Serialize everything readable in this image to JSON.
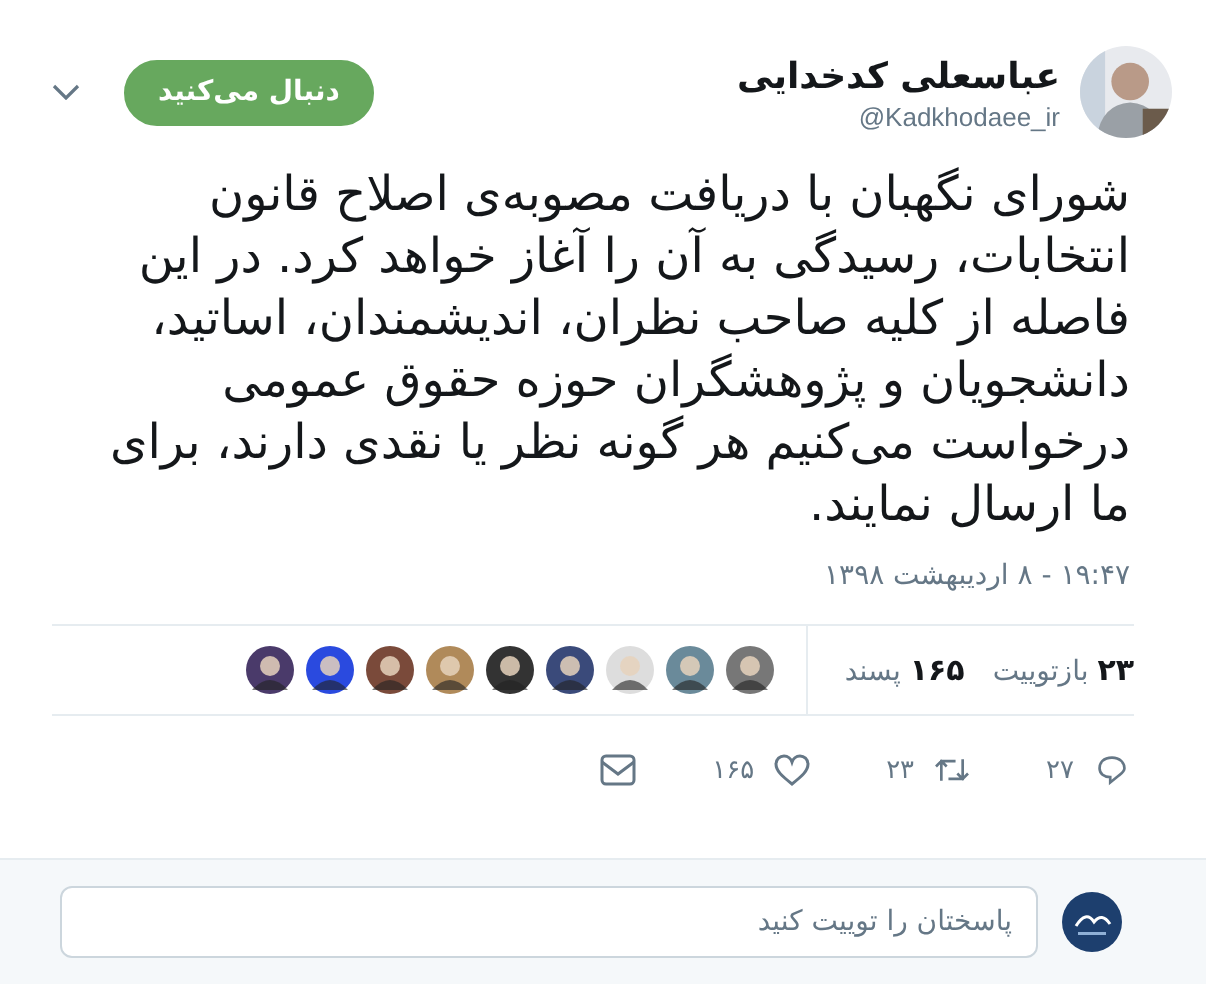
{
  "author": {
    "name": "عباسعلی کدخدایی",
    "handle": "@Kadkhodaee_ir"
  },
  "follow_button": {
    "label": "دنبال می‌کنید",
    "following": true
  },
  "text": "شورای نگهبان با دریافت مصوبه‌ی اصلاح قانون انتخابات، رسیدگی به آن را آغاز خواهد کرد. در این فاصله از کلیه صاحب نظران، اندیشمندان، اساتید، دانشجویان و پژوهشگران حوزه حقوق عمومی درخواست می‌کنیم هر گونه نظر یا نقدی دارند، برای ما ارسال نمایند.",
  "timestamp": "۱۹:۴۷ - ۸ اردیبهشت ۱۳۹۸",
  "stats": [
    {
      "count": "۲۳",
      "label": "بازتوییت"
    },
    {
      "count": "۱۶۵",
      "label": "پسند"
    }
  ],
  "actions": [
    {
      "kind": "reply",
      "count": "۲۷"
    },
    {
      "kind": "retweet",
      "count": "۲۳"
    },
    {
      "kind": "like",
      "count": "۱۶۵"
    },
    {
      "kind": "message"
    }
  ],
  "reply_box": {
    "placeholder": "پاسختان را توییت کنید"
  }
}
